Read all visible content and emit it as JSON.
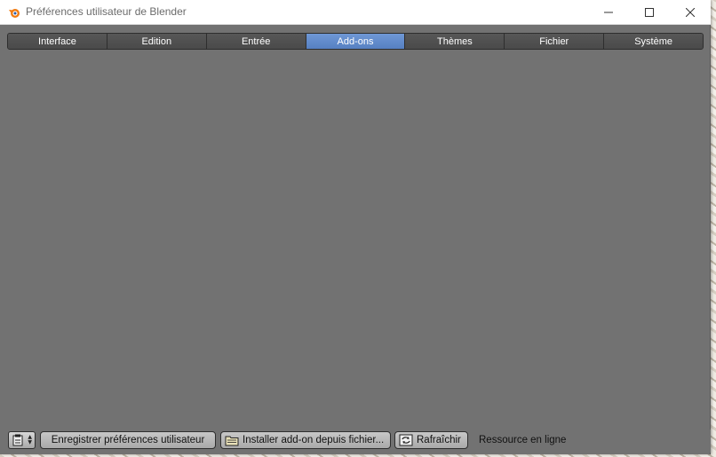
{
  "window": {
    "title": "Préférences utilisateur de Blender"
  },
  "tabs": [
    {
      "label": "Interface",
      "active": false
    },
    {
      "label": "Edition",
      "active": false
    },
    {
      "label": "Entrée",
      "active": false
    },
    {
      "label": "Add-ons",
      "active": true
    },
    {
      "label": "Thèmes",
      "active": false
    },
    {
      "label": "Fichier",
      "active": false
    },
    {
      "label": "Système",
      "active": false
    }
  ],
  "footer": {
    "save_label": "Enregistrer préférences utilisateur",
    "install_label": "Installer add-on depuis fichier...",
    "refresh_label": "Rafraîchir",
    "online_label": "Ressource en ligne"
  },
  "icons": {
    "app": "blender-logo-icon",
    "editor_type": "preferences-editor-icon",
    "install": "folder-icon",
    "refresh": "refresh-icon"
  },
  "colors": {
    "active_tab": "#5680c2",
    "panel_bg": "#727272",
    "tab_bg": "#4a4a4a"
  }
}
